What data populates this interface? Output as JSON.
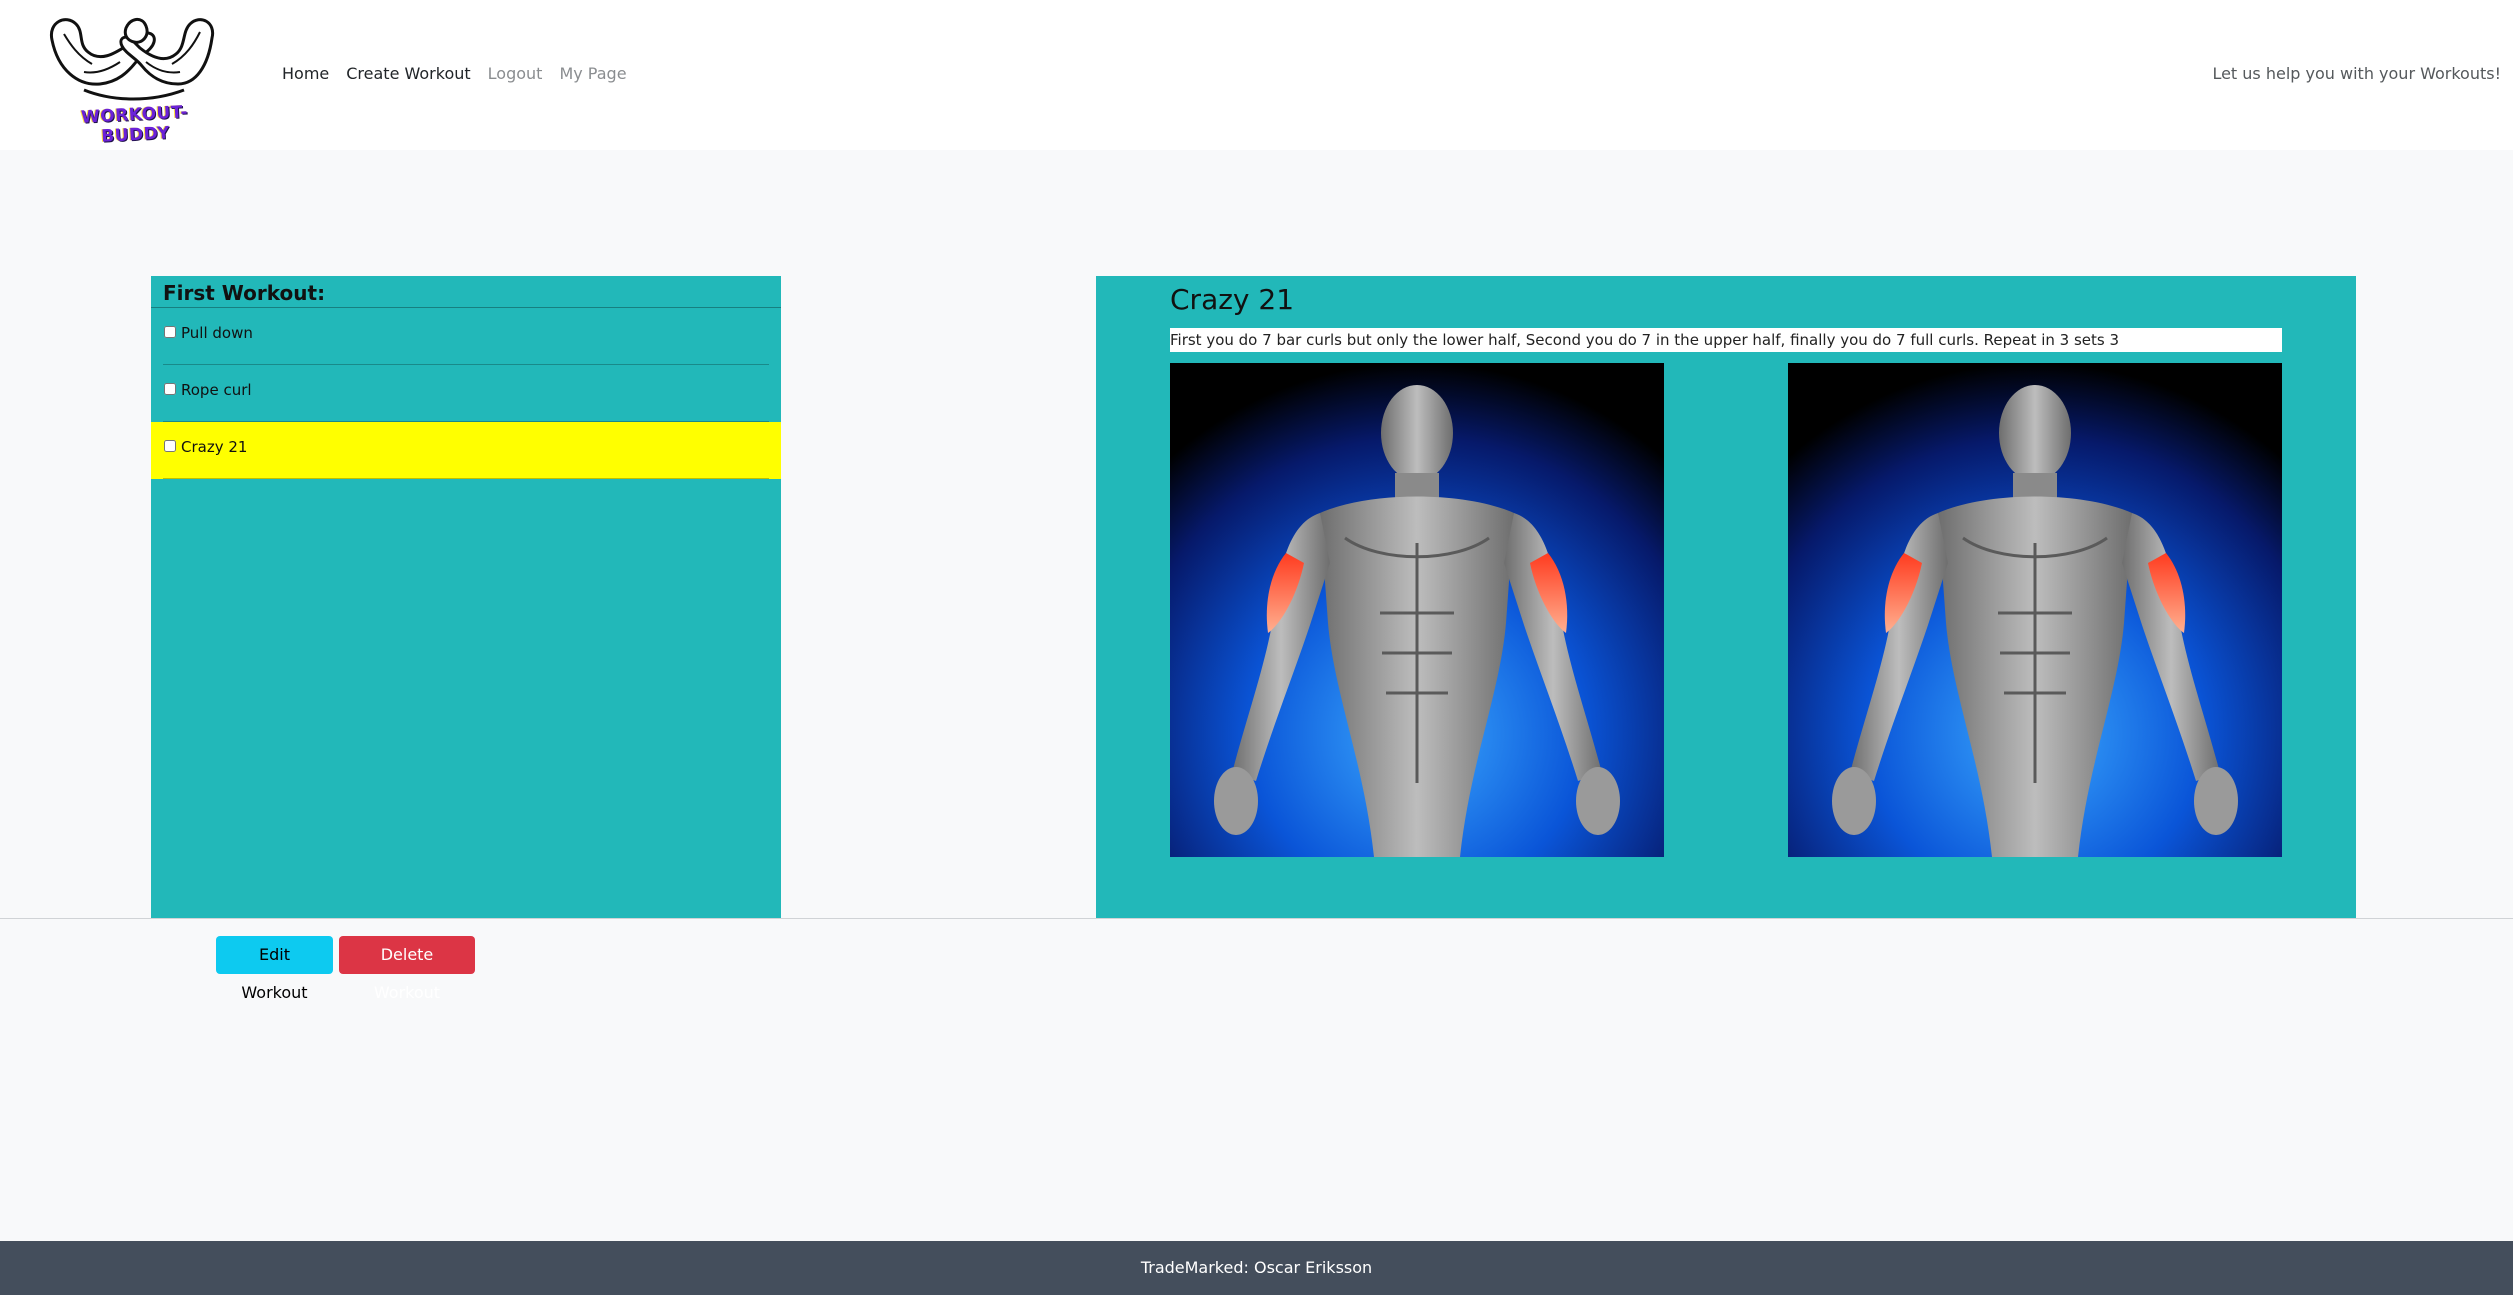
{
  "nav": {
    "logo_text": "WORKOUT-BUDDY",
    "links": [
      {
        "label": "Home",
        "state": "active"
      },
      {
        "label": "Create Workout",
        "state": "active"
      },
      {
        "label": "Logout",
        "state": "muted"
      },
      {
        "label": "My Page",
        "state": "muted"
      }
    ],
    "tagline": "Let us help you with your Workouts!"
  },
  "workout": {
    "title": "First Workout:",
    "exercises": [
      {
        "label": "Pull down",
        "checked": false,
        "highlighted": false
      },
      {
        "label": "Rope curl",
        "checked": false,
        "highlighted": false
      },
      {
        "label": "Crazy 21",
        "checked": false,
        "highlighted": true
      }
    ],
    "edit_label": "Edit Workout",
    "delete_label": "Delete Workout"
  },
  "detail": {
    "title": "Crazy 21",
    "description": "First you do 7 bar curls but only the lower half, Second you do 7 in the upper half, finally you do 7 full curls. Repeat in 3 sets 3",
    "images": [
      "muscle-anatomy-biceps-image",
      "muscle-anatomy-biceps-image"
    ]
  },
  "footer": {
    "text": "TradeMarked: Oscar Eriksson"
  },
  "colors": {
    "panel": "#22b8b9",
    "highlight": "#ffff00",
    "edit_button": "#0dcaf0",
    "delete_button": "#dc3545",
    "footer": "#444e5c"
  }
}
